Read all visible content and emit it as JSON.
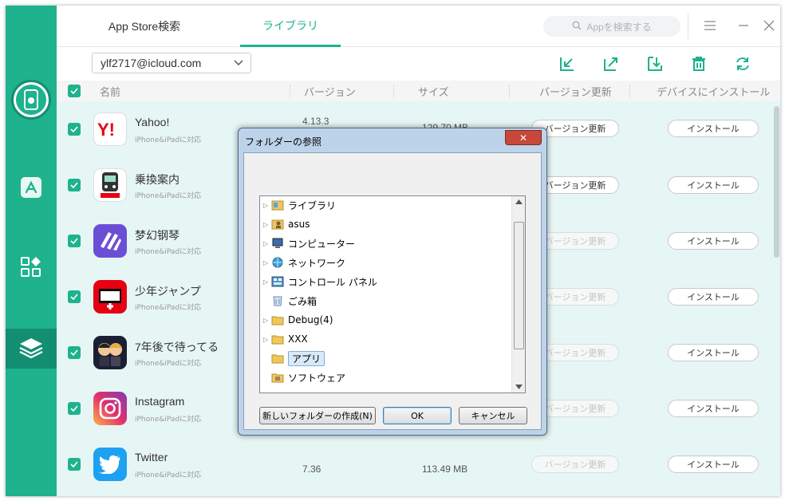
{
  "tabs": [
    {
      "label": "App Store検索",
      "active": false
    },
    {
      "label": "ライブラリ",
      "active": true
    }
  ],
  "search": {
    "placeholder": "Appを検索する"
  },
  "account": {
    "email": "ylf2717@icloud.com"
  },
  "columns": {
    "name": "名前",
    "version": "バージョン",
    "size": "サイズ",
    "update": "バージョン更新",
    "install": "デバイスにインストール"
  },
  "apps": [
    {
      "name": "Yahoo!",
      "sub": "iPhone&iPadに対応",
      "version": "4.13.3",
      "size": "129.70 MB",
      "update_label": "バージョン更新",
      "update_enabled": true,
      "install_label": "インストール"
    },
    {
      "name": "乗換案内",
      "sub": "iPhone&iPadに対応",
      "version": "",
      "size": "",
      "update_label": "バージョン更新",
      "update_enabled": true,
      "install_label": "インストール"
    },
    {
      "name": "梦幻钢琴",
      "sub": "iPhone&iPadに対応",
      "version": "",
      "size": "",
      "update_label": "バージョン更新",
      "update_enabled": false,
      "install_label": "インストール"
    },
    {
      "name": "少年ジャンプ",
      "sub": "iPhone&iPadに対応",
      "version": "",
      "size": "",
      "update_label": "バージョン更新",
      "update_enabled": false,
      "install_label": "インストール"
    },
    {
      "name": "7年後で待ってる",
      "sub": "iPhone&iPadに対応",
      "version": "",
      "size": "",
      "update_label": "バージョン更新",
      "update_enabled": false,
      "install_label": "インストール"
    },
    {
      "name": "Instagram",
      "sub": "iPhone&iPadに対応",
      "version": "",
      "size": "",
      "update_label": "バージョン更新",
      "update_enabled": false,
      "install_label": "インストール"
    },
    {
      "name": "Twitter",
      "sub": "iPhone&iPadに対応",
      "version": "7.36",
      "size": "113.49 MB",
      "update_label": "バージョン更新",
      "update_enabled": false,
      "install_label": "インストール"
    }
  ],
  "dialog": {
    "title": "フォルダーの参照",
    "close_label": "✕",
    "tree": [
      {
        "label": "ライブラリ",
        "expandable": true,
        "icon": "library-icon",
        "selected": false
      },
      {
        "label": "asus",
        "expandable": true,
        "icon": "user-folder-icon",
        "selected": false
      },
      {
        "label": "コンピューター",
        "expandable": true,
        "icon": "computer-icon",
        "selected": false
      },
      {
        "label": "ネットワーク",
        "expandable": true,
        "icon": "network-icon",
        "selected": false
      },
      {
        "label": "コントロール パネル",
        "expandable": true,
        "icon": "control-panel-icon",
        "selected": false
      },
      {
        "label": "ごみ箱",
        "expandable": false,
        "icon": "recycle-bin-icon",
        "selected": false
      },
      {
        "label": "Debug(4)",
        "expandable": true,
        "icon": "folder-icon",
        "selected": false
      },
      {
        "label": "XXX",
        "expandable": true,
        "icon": "folder-icon",
        "selected": false
      },
      {
        "label": "アプリ",
        "expandable": false,
        "icon": "folder-icon",
        "selected": true
      },
      {
        "label": "ソフトウェア",
        "expandable": false,
        "icon": "software-folder-icon",
        "selected": false
      }
    ],
    "new_folder_label": "新しいフォルダーの作成(N)",
    "ok_label": "OK",
    "cancel_label": "キャンセル"
  },
  "colors": {
    "accent": "#1eb28d",
    "accent_dark": "#138e70",
    "list_bg": "#e6f6f4"
  }
}
